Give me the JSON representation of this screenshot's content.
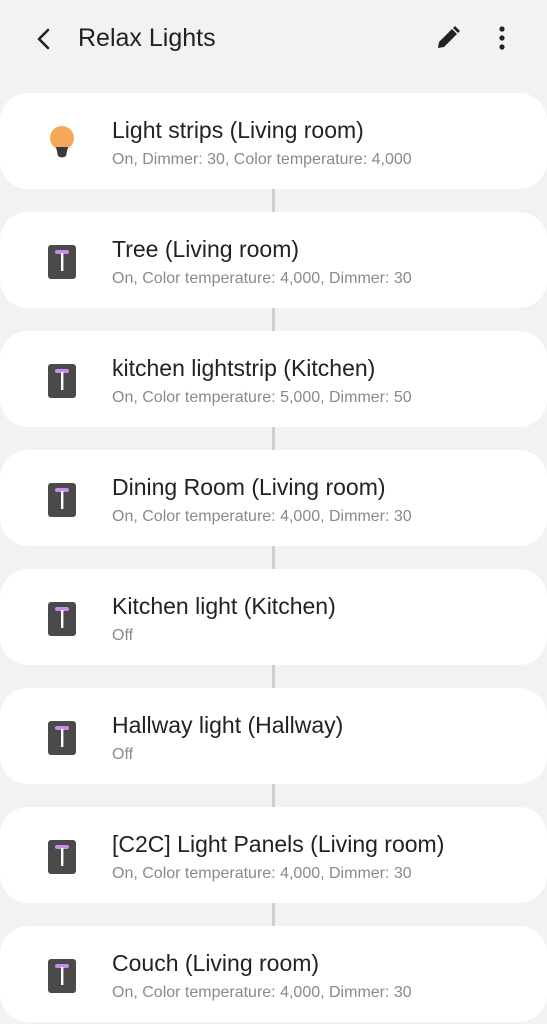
{
  "header": {
    "title": "Relax Lights",
    "back_icon": "back-arrow-icon",
    "edit_icon": "pencil-icon",
    "more_icon": "more-vertical-icon"
  },
  "devices": [
    {
      "name": "Light strips (Living room)",
      "status": "On, Dimmer: 30, Color temperature: 4,000",
      "icon": "bulb-icon"
    },
    {
      "name": "Tree (Living room)",
      "status": "On, Color temperature: 4,000, Dimmer: 30",
      "icon": "light-fixture-icon"
    },
    {
      "name": "kitchen lightstrip (Kitchen)",
      "status": "On, Color temperature: 5,000, Dimmer: 50",
      "icon": "light-fixture-icon"
    },
    {
      "name": "Dining Room (Living room)",
      "status": "On, Color temperature: 4,000, Dimmer: 30",
      "icon": "light-fixture-icon"
    },
    {
      "name": "Kitchen light (Kitchen)",
      "status": "Off",
      "icon": "light-fixture-icon"
    },
    {
      "name": "Hallway light (Hallway)",
      "status": "Off",
      "icon": "light-fixture-icon"
    },
    {
      "name": "[C2C] Light Panels (Living room)",
      "status": "On, Color temperature: 4,000, Dimmer: 30",
      "icon": "light-fixture-icon"
    },
    {
      "name": "Couch (Living room)",
      "status": "On, Color temperature: 4,000, Dimmer: 30",
      "icon": "light-fixture-icon"
    }
  ],
  "colors": {
    "bulb": "#f6a85a",
    "bulb_base": "#3a3a3a",
    "fixture_body": "#4a4a4a",
    "fixture_light": "#c88cf0"
  }
}
